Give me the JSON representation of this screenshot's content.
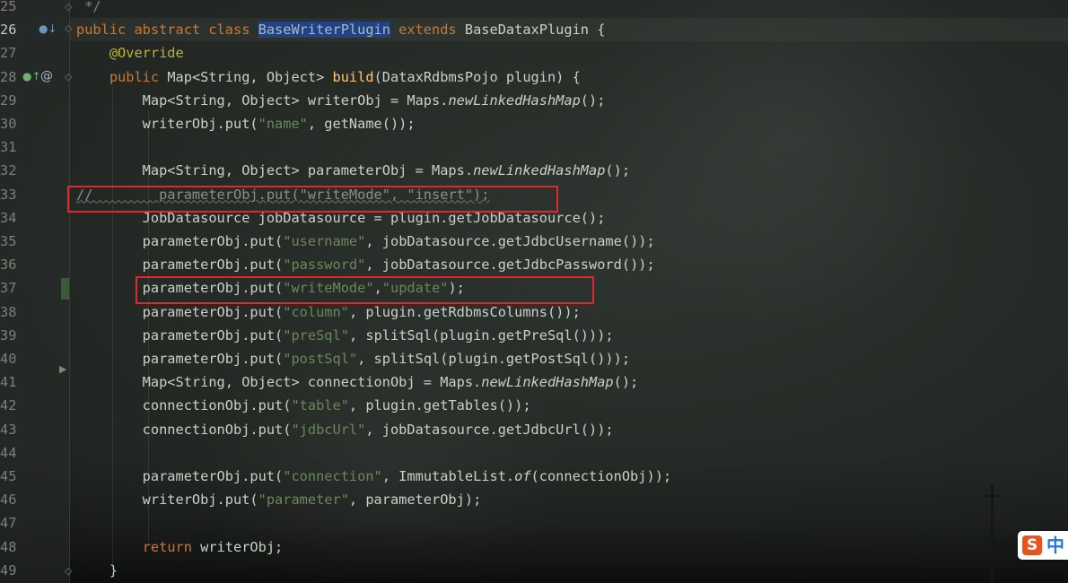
{
  "editor": {
    "lines": [
      {
        "num": "25",
        "tokens": [
          {
            "t": " */",
            "c": "cm"
          }
        ]
      },
      {
        "num": "26",
        "tokens": [
          {
            "t": "public abstract class ",
            "c": "kw"
          },
          {
            "t": "BaseWriterPlugin",
            "c": "cls-hl"
          },
          {
            "t": " extends ",
            "c": "kw"
          },
          {
            "t": "BaseDataxPlugin {",
            "c": ""
          }
        ]
      },
      {
        "num": "27",
        "tokens": [
          {
            "t": "    ",
            "c": ""
          },
          {
            "t": "@Override",
            "c": "an"
          }
        ]
      },
      {
        "num": "28",
        "tokens": [
          {
            "t": "    ",
            "c": ""
          },
          {
            "t": "public ",
            "c": "kw"
          },
          {
            "t": "Map<String, Object> ",
            "c": ""
          },
          {
            "t": "build",
            "c": "mt"
          },
          {
            "t": "(DataxRdbmsPojo plugin) {",
            "c": ""
          }
        ]
      },
      {
        "num": "29",
        "tokens": [
          {
            "t": "        Map<String, Object> writerObj = Maps.",
            "c": ""
          },
          {
            "t": "newLinkedHashMap",
            "c": "it"
          },
          {
            "t": "();",
            "c": ""
          }
        ]
      },
      {
        "num": "30",
        "tokens": [
          {
            "t": "        writerObj.put(",
            "c": ""
          },
          {
            "t": "\"name\"",
            "c": "str"
          },
          {
            "t": ", getName());",
            "c": ""
          }
        ]
      },
      {
        "num": "31",
        "tokens": []
      },
      {
        "num": "32",
        "tokens": [
          {
            "t": "        Map<String, Object> parameterObj = Maps.",
            "c": ""
          },
          {
            "t": "newLinkedHashMap",
            "c": "it"
          },
          {
            "t": "();",
            "c": ""
          }
        ]
      },
      {
        "num": "33",
        "tokens": [
          {
            "t": "//        parameterObj.put(\"writeMode\", \"insert\");",
            "c": "dimcode"
          }
        ]
      },
      {
        "num": "34",
        "tokens": [
          {
            "t": "        JobDatasource jobDatasource = plugin.getJobDatasource();",
            "c": ""
          }
        ]
      },
      {
        "num": "35",
        "tokens": [
          {
            "t": "        parameterObj.put(",
            "c": ""
          },
          {
            "t": "\"username\"",
            "c": "str"
          },
          {
            "t": ", jobDatasource.getJdbcUsername());",
            "c": ""
          }
        ]
      },
      {
        "num": "36",
        "tokens": [
          {
            "t": "        parameterObj.put(",
            "c": ""
          },
          {
            "t": "\"password\"",
            "c": "str"
          },
          {
            "t": ", jobDatasource.getJdbcPassword());",
            "c": ""
          }
        ]
      },
      {
        "num": "37",
        "tokens": [
          {
            "t": "        parameterObj.put(",
            "c": ""
          },
          {
            "t": "\"writeMode\"",
            "c": "str"
          },
          {
            "t": ",",
            "c": ""
          },
          {
            "t": "\"update\"",
            "c": "str"
          },
          {
            "t": ");",
            "c": ""
          }
        ]
      },
      {
        "num": "38",
        "tokens": [
          {
            "t": "        parameterObj.put(",
            "c": ""
          },
          {
            "t": "\"column\"",
            "c": "str"
          },
          {
            "t": ", plugin.getRdbmsColumns());",
            "c": ""
          }
        ]
      },
      {
        "num": "39",
        "tokens": [
          {
            "t": "        parameterObj.put(",
            "c": ""
          },
          {
            "t": "\"preSql\"",
            "c": "str"
          },
          {
            "t": ", splitSql(plugin.getPreSql()));",
            "c": ""
          }
        ]
      },
      {
        "num": "40",
        "tokens": [
          {
            "t": "        parameterObj.put(",
            "c": ""
          },
          {
            "t": "\"postSql\"",
            "c": "str"
          },
          {
            "t": ", splitSql(plugin.getPostSql()));",
            "c": ""
          }
        ]
      },
      {
        "num": "41",
        "tokens": [
          {
            "t": "        Map<String, Object> connectionObj = Maps.",
            "c": ""
          },
          {
            "t": "newLinkedHashMap",
            "c": "it"
          },
          {
            "t": "();",
            "c": ""
          }
        ]
      },
      {
        "num": "42",
        "tokens": [
          {
            "t": "        connectionObj.put(",
            "c": ""
          },
          {
            "t": "\"table\"",
            "c": "str"
          },
          {
            "t": ", plugin.getTables());",
            "c": ""
          }
        ]
      },
      {
        "num": "43",
        "tokens": [
          {
            "t": "        connectionObj.put(",
            "c": ""
          },
          {
            "t": "\"jdbcUrl\"",
            "c": "str"
          },
          {
            "t": ", jobDatasource.getJdbcUrl());",
            "c": ""
          }
        ]
      },
      {
        "num": "44",
        "tokens": []
      },
      {
        "num": "45",
        "tokens": [
          {
            "t": "        parameterObj.put(",
            "c": ""
          },
          {
            "t": "\"connection\"",
            "c": "str"
          },
          {
            "t": ", ImmutableList.",
            "c": ""
          },
          {
            "t": "of",
            "c": "it"
          },
          {
            "t": "(connectionObj));",
            "c": ""
          }
        ]
      },
      {
        "num": "46",
        "tokens": [
          {
            "t": "        writerObj.put(",
            "c": ""
          },
          {
            "t": "\"parameter\"",
            "c": "str"
          },
          {
            "t": ", parameterObj);",
            "c": ""
          }
        ]
      },
      {
        "num": "47",
        "tokens": []
      },
      {
        "num": "48",
        "tokens": [
          {
            "t": "        ",
            "c": ""
          },
          {
            "t": "return ",
            "c": "kw"
          },
          {
            "t": "writerObj;",
            "c": ""
          }
        ]
      },
      {
        "num": "49",
        "tokens": [
          {
            "t": "    }",
            "c": ""
          }
        ]
      }
    ]
  },
  "gutter_icons": {
    "line26": "implemented-by-icon",
    "line28_override": "override-method-icon",
    "line28_at": "@"
  },
  "ime": {
    "logo": "S",
    "mode": "中"
  },
  "colors": {
    "keyword": "#cc7832",
    "annotation": "#bbb529",
    "string": "#6a8759",
    "method": "#ffc66d",
    "highlight_box": "#e0282a",
    "selection": "#214283"
  }
}
